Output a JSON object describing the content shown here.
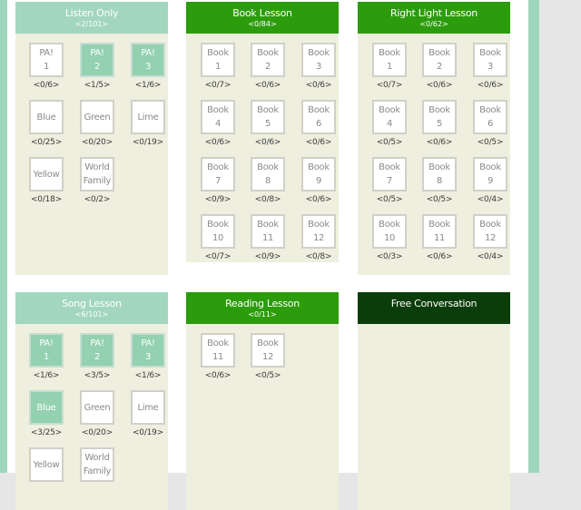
{
  "panels": [
    {
      "id": "listen-only",
      "title": "Listen Only",
      "sub": "<2/101>",
      "theme": "light",
      "cols": [
        0,
        56,
        112
      ],
      "tiles": [
        {
          "l1": "PA!",
          "l2": "1",
          "count": "<0/6>",
          "done": false
        },
        {
          "l1": "PA!",
          "l2": "2",
          "count": "<1/5>",
          "done": true
        },
        {
          "l1": "PA!",
          "l2": "3",
          "count": "<1/6>",
          "done": true
        },
        {
          "l1": "Blue",
          "l2": "",
          "count": "<0/25>",
          "done": false
        },
        {
          "l1": "Green",
          "l2": "",
          "count": "<0/20>",
          "done": false
        },
        {
          "l1": "Lime",
          "l2": "",
          "count": "<0/19>",
          "done": false
        },
        {
          "l1": "Yellow",
          "l2": "",
          "count": "<0/18>",
          "done": false
        },
        {
          "l1": "World",
          "l2": "Family",
          "count": "<0/2>",
          "done": false
        }
      ]
    },
    {
      "id": "book-lesson",
      "title": "Book Lesson",
      "sub": "<0/84>",
      "theme": "green",
      "cols": [
        0,
        55,
        111
      ],
      "tiles": [
        {
          "l1": "Book",
          "l2": "1",
          "count": "<0/7>",
          "done": false
        },
        {
          "l1": "Book",
          "l2": "2",
          "count": "<0/6>",
          "done": false
        },
        {
          "l1": "Book",
          "l2": "3",
          "count": "<0/6>",
          "done": false
        },
        {
          "l1": "Book",
          "l2": "4",
          "count": "<0/6>",
          "done": false
        },
        {
          "l1": "Book",
          "l2": "5",
          "count": "<0/6>",
          "done": false
        },
        {
          "l1": "Book",
          "l2": "6",
          "count": "<0/6>",
          "done": false
        },
        {
          "l1": "Book",
          "l2": "7",
          "count": "<0/9>",
          "done": false
        },
        {
          "l1": "Book",
          "l2": "8",
          "count": "<0/8>",
          "done": false
        },
        {
          "l1": "Book",
          "l2": "9",
          "count": "<0/6>",
          "done": false
        },
        {
          "l1": "Book",
          "l2": "10",
          "count": "<0/7>",
          "done": false
        },
        {
          "l1": "Book",
          "l2": "11",
          "count": "<0/9>",
          "done": false
        },
        {
          "l1": "Book",
          "l2": "12",
          "count": "<0/8>",
          "done": false
        }
      ]
    },
    {
      "id": "right-light-lesson",
      "title": "Right Light Lesson",
      "sub": "<0/62>",
      "theme": "green",
      "cols": [
        0,
        55,
        111
      ],
      "tiles": [
        {
          "l1": "Book",
          "l2": "1",
          "count": "<0/7>",
          "done": false
        },
        {
          "l1": "Book",
          "l2": "2",
          "count": "<0/6>",
          "done": false
        },
        {
          "l1": "Book",
          "l2": "3",
          "count": "<0/6>",
          "done": false
        },
        {
          "l1": "Book",
          "l2": "4",
          "count": "<0/5>",
          "done": false
        },
        {
          "l1": "Book",
          "l2": "5",
          "count": "<0/6>",
          "done": false
        },
        {
          "l1": "Book",
          "l2": "6",
          "count": "<0/5>",
          "done": false
        },
        {
          "l1": "Book",
          "l2": "7",
          "count": "<0/5>",
          "done": false
        },
        {
          "l1": "Book",
          "l2": "8",
          "count": "<0/5>",
          "done": false
        },
        {
          "l1": "Book",
          "l2": "9",
          "count": "<0/4>",
          "done": false
        },
        {
          "l1": "Book",
          "l2": "10",
          "count": "<0/3>",
          "done": false
        },
        {
          "l1": "Book",
          "l2": "11",
          "count": "<0/6>",
          "done": false
        },
        {
          "l1": "Book",
          "l2": "12",
          "count": "<0/4>",
          "done": false
        }
      ]
    },
    {
      "id": "song-lesson",
      "title": "Song Lesson",
      "sub": "<6/101>",
      "theme": "light",
      "cols": [
        0,
        56,
        112
      ],
      "tiles": [
        {
          "l1": "PA!",
          "l2": "1",
          "count": "<1/6>",
          "done": true
        },
        {
          "l1": "PA!",
          "l2": "2",
          "count": "<3/5>",
          "done": true
        },
        {
          "l1": "PA!",
          "l2": "3",
          "count": "<1/6>",
          "done": true
        },
        {
          "l1": "Blue",
          "l2": "",
          "count": "<3/25>",
          "done": true
        },
        {
          "l1": "Green",
          "l2": "",
          "count": "<0/20>",
          "done": false
        },
        {
          "l1": "Lime",
          "l2": "",
          "count": "<0/19>",
          "done": false
        },
        {
          "l1": "Yellow",
          "l2": "",
          "count": "",
          "done": false
        },
        {
          "l1": "World",
          "l2": "Family",
          "count": "",
          "done": false
        }
      ]
    },
    {
      "id": "reading-lesson",
      "title": "Reading Lesson",
      "sub": "<0/11>",
      "theme": "green",
      "cols": [
        0,
        55,
        111
      ],
      "tiles": [
        {
          "l1": "Book",
          "l2": "11",
          "count": "<0/6>",
          "done": false
        },
        {
          "l1": "Book",
          "l2": "12",
          "count": "<0/5>",
          "done": false
        }
      ]
    },
    {
      "id": "free-conversation",
      "title": "Free Conversation",
      "sub": "",
      "theme": "dark",
      "cols": [
        0,
        55,
        111
      ],
      "tiles": []
    }
  ]
}
